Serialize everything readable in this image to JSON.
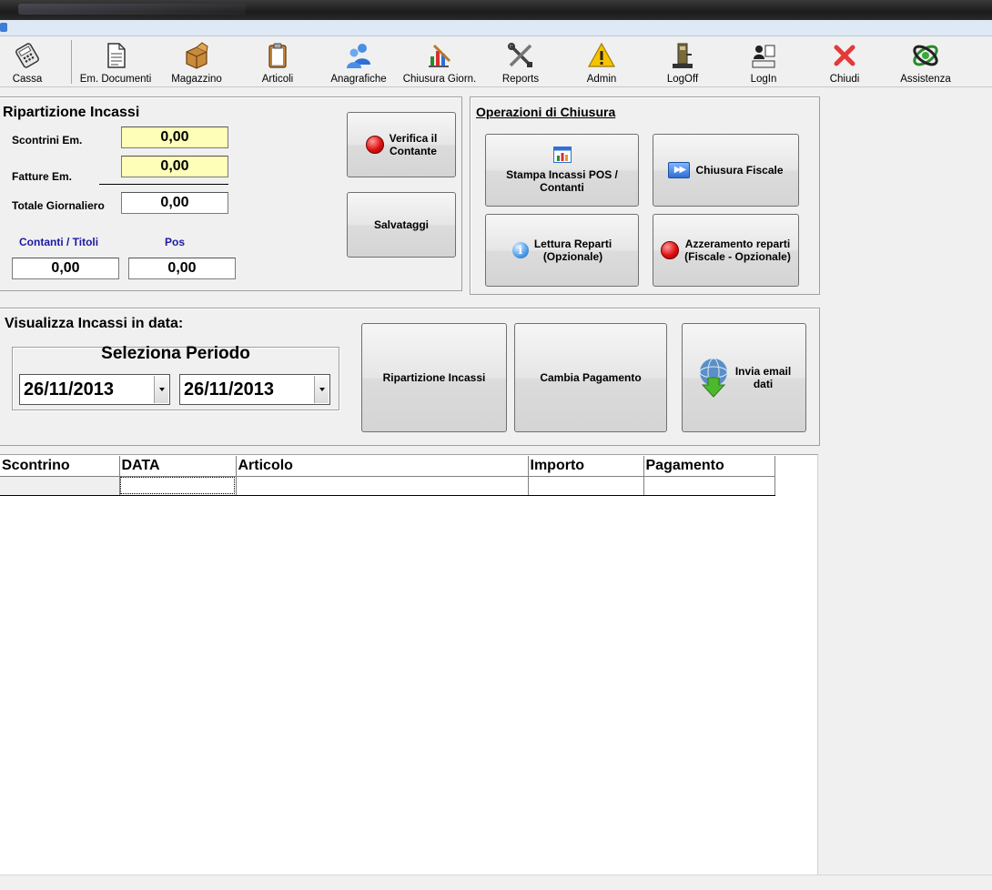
{
  "toolbar": {
    "items": [
      {
        "label": "Cassa",
        "icon": "calculator-icon"
      },
      {
        "label": "Em. Documenti",
        "icon": "document-icon"
      },
      {
        "label": "Magazzino",
        "icon": "box-icon"
      },
      {
        "label": "Articoli",
        "icon": "clipboard-icon"
      },
      {
        "label": "Anagrafiche",
        "icon": "users-icon"
      },
      {
        "label": "Chiusura Giorn.",
        "icon": "chart-pen-icon"
      },
      {
        "label": "Reports",
        "icon": "tools-icon"
      },
      {
        "label": "Admin",
        "icon": "warning-icon"
      },
      {
        "label": "LogOff",
        "icon": "logoff-icon"
      },
      {
        "label": "LogIn",
        "icon": "login-icon"
      },
      {
        "label": "Chiudi",
        "icon": "close-icon"
      },
      {
        "label": "Assistenza",
        "icon": "support-icon"
      }
    ]
  },
  "ripartizione": {
    "title": "Ripartizione Incassi",
    "scontrini_label": "Scontrini Em.",
    "scontrini_value": "0,00",
    "fatture_label": "Fatture Em.",
    "fatture_value": "0,00",
    "totale_label": "Totale Giornaliero",
    "totale_value": "0,00",
    "contanti_label": "Contanti / Titoli",
    "contanti_value": "0,00",
    "pos_label": "Pos",
    "pos_value": "0,00",
    "verifica_label_1": "Verifica il",
    "verifica_label_2": "Contante",
    "salvataggi_label": "Salvataggi"
  },
  "chiusura": {
    "title": "Operazioni di Chiusura",
    "stampa_label_1": "Stampa Incassi POS /",
    "stampa_label_2": "Contanti",
    "fiscale_label": "Chiusura Fiscale",
    "lettura_label_1": "Lettura Reparti",
    "lettura_label_2": "(Opzionale)",
    "azzeramento_label_1": "Azzeramento reparti",
    "azzeramento_label_2": "(Fiscale - Opzionale)"
  },
  "visualizza": {
    "title": "Visualizza Incassi in data:",
    "periodo_label": "Seleziona Periodo",
    "date_from": "26/11/2013",
    "date_to": "26/11/2013",
    "ripartizione_btn": "Ripartizione Incassi",
    "cambia_btn": "Cambia Pagamento",
    "email_label_1": "Invia email",
    "email_label_2": "dati"
  },
  "grid": {
    "columns": [
      "Scontrino",
      "DATA",
      "Articolo",
      "Importo",
      "Pagamento"
    ]
  },
  "colors": {
    "yellow_field": "#fefeb8",
    "blue_label": "#1a1aa5"
  }
}
